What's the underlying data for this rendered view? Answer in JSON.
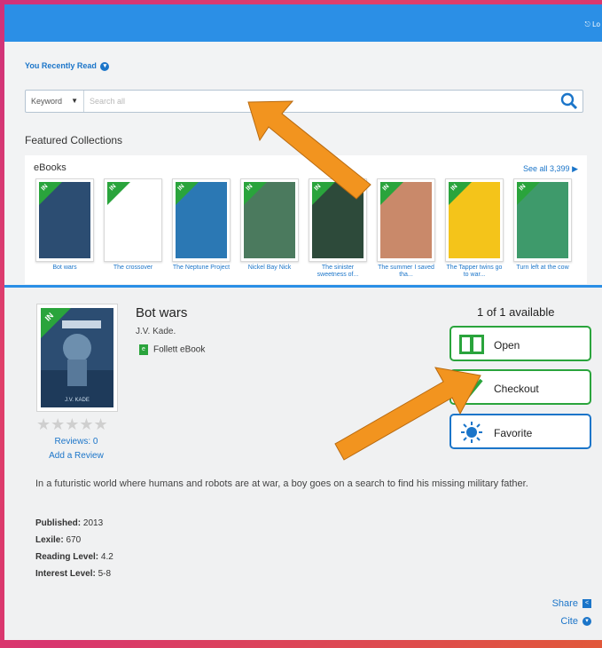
{
  "header": {
    "logout_label": "Lo"
  },
  "recently_read": {
    "label": "You Recently Read",
    "chevron": "chevron-down-icon"
  },
  "search": {
    "mode": "Keyword",
    "placeholder": "Search all"
  },
  "featured": {
    "heading": "Featured Collections",
    "collection_label": "eBooks",
    "see_all": "See all 3,399",
    "books": [
      {
        "title": "Bot wars",
        "badge": "IN",
        "cover_color": "#2c4d72"
      },
      {
        "title": "The crossover",
        "badge": "IN",
        "cover_color": "#ffffff"
      },
      {
        "title": "The Neptune Project",
        "badge": "IN",
        "cover_color": "#2b78b4"
      },
      {
        "title": "Nickel Bay Nick",
        "badge": "IN",
        "cover_color": "#4b7a5e"
      },
      {
        "title": "The sinister sweetness of...",
        "badge": "IN",
        "cover_color": "#2d4a3a"
      },
      {
        "title": "The summer I saved tha...",
        "badge": "IN",
        "cover_color": "#c9896a"
      },
      {
        "title": "The Tapper twins go to war...",
        "badge": "IN",
        "cover_color": "#f4c41a"
      },
      {
        "title": "Turn left at the cow",
        "badge": "IN",
        "cover_color": "#3e9a6b"
      }
    ]
  },
  "detail": {
    "badge": "IN",
    "title": "Bot wars",
    "author": "J.V. Kade.",
    "format": "Follett eBook",
    "rating_stars": "★★★★★",
    "reviews": "Reviews: 0",
    "add_review": "Add a Review",
    "availability": "1 of 1 available",
    "open_label": "Open",
    "checkout_label": "Checkout",
    "favorite_label": "Favorite",
    "description": "In a futuristic world where humans and robots are at war, a boy goes on a search to find his missing military father.",
    "meta": {
      "published_label": "Published:",
      "published": "2013",
      "lexile_label": "Lexile:",
      "lexile": "670",
      "reading_label": "Reading Level:",
      "reading": "4.2",
      "interest_label": "Interest Level:",
      "interest": "5-8"
    },
    "share": "Share",
    "cite": "Cite"
  },
  "colors": {
    "accent": "#2b8fe6",
    "green": "#2aa43c",
    "arrow": "#f2941f"
  }
}
